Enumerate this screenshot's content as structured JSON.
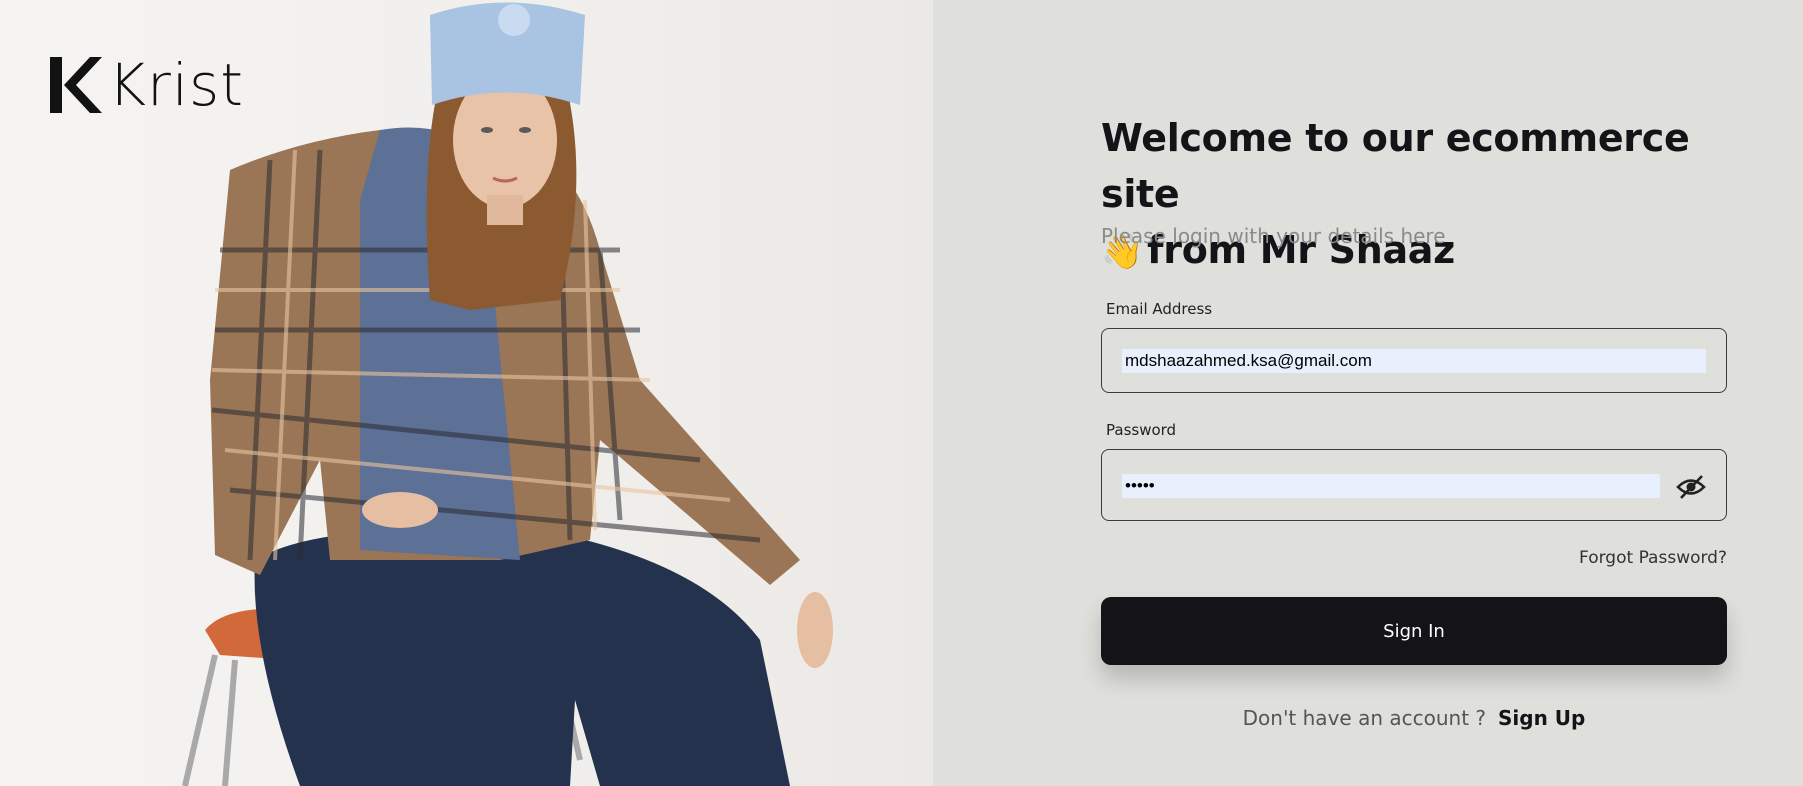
{
  "brand": {
    "name": "Krist",
    "logo_icon": "k-mark-icon"
  },
  "hero": {
    "image": "woman-seated-plaid-jacket-beanie"
  },
  "login": {
    "heading_line1": "Welcome to our ecommerce site",
    "heading_emoji": "👋",
    "heading_line2": "from Mr Shaaz",
    "subtitle": "Please login with your details here",
    "email_label": "Email Address",
    "email_value": "mdshaazahmed.ksa@gmail.com",
    "password_label": "Password",
    "password_value": "•••••",
    "password_toggle_icon": "eye-off-icon",
    "forgot": "Forgot Password?",
    "signin": "Sign In",
    "no_account": "Don't have an account ?",
    "signup": "Sign Up"
  },
  "colors": {
    "button": "#131318",
    "panel": "#dfdfdb",
    "autofill": "#e8f0fe"
  }
}
